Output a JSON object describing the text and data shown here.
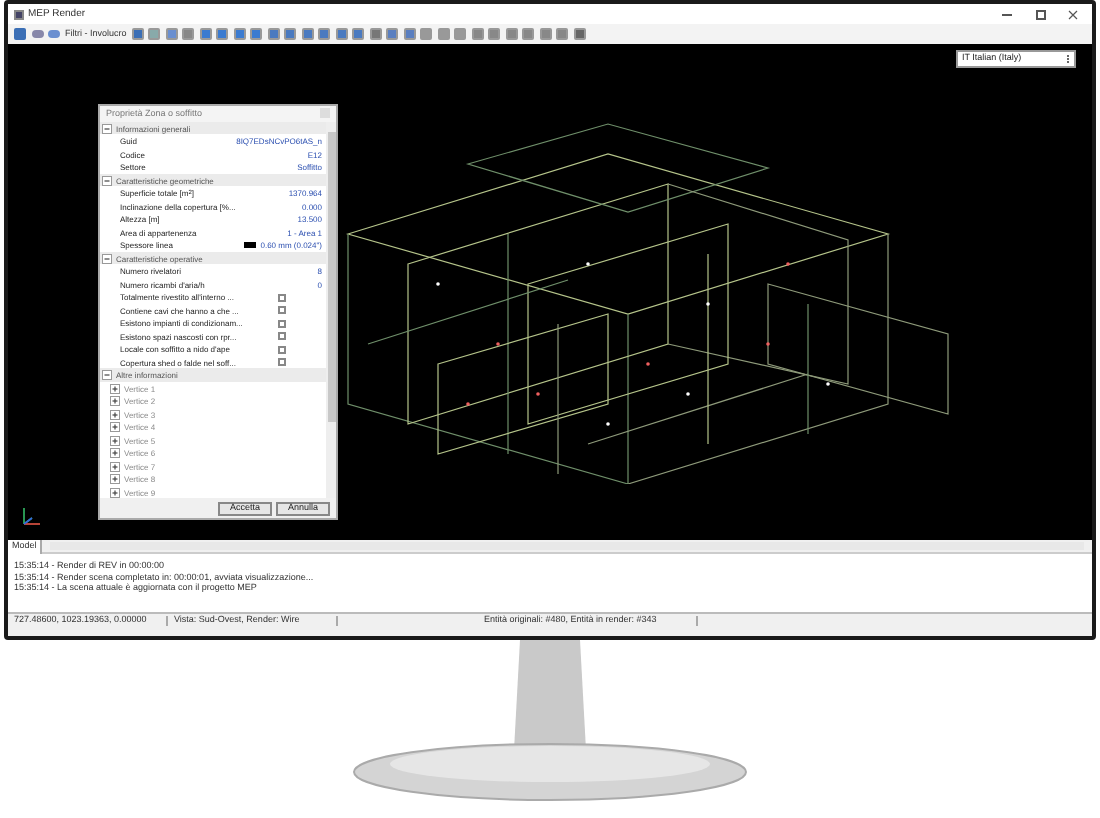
{
  "window": {
    "title": "MEP Render"
  },
  "toolbar": {
    "filter_label": "Filtri - Involucro"
  },
  "language_select": {
    "value": "IT Italian (Italy)"
  },
  "properties_panel": {
    "title": "Proprietà Zona o soffitto",
    "sections": [
      {
        "title": "Informazioni generali",
        "expanded": true,
        "rows": [
          {
            "kind": "text",
            "label": "Guid",
            "value": "8IQ7EDsNCvPO6tAS_n"
          },
          {
            "kind": "text",
            "label": "Codice",
            "value": "E12"
          },
          {
            "kind": "text",
            "label": "Settore",
            "value": "Soffitto"
          }
        ]
      },
      {
        "title": "Caratteristiche geometriche",
        "expanded": true,
        "rows": [
          {
            "kind": "text",
            "label": "Superficie totale [m$^{2}$]",
            "value": "1370.964"
          },
          {
            "kind": "text",
            "label": "Inclinazione della copertura [%...",
            "value": "0.000"
          },
          {
            "kind": "text",
            "label": "Altezza [m]",
            "value": "13.500"
          },
          {
            "kind": "text",
            "label": "Area di appartenenza",
            "value": "1 - Area 1"
          },
          {
            "kind": "line",
            "label": "Spessore linea",
            "value": "0.60 mm (0.024\")"
          }
        ]
      },
      {
        "title": "Caratteristiche operative",
        "expanded": true,
        "rows": [
          {
            "kind": "text",
            "label": "Numero rivelatori",
            "value": "8"
          },
          {
            "kind": "text",
            "label": "Numero ricambi d'aria/h",
            "value": "0"
          },
          {
            "kind": "checkbox",
            "label": "Totalmente rivestito all'interno ...",
            "checked": false
          },
          {
            "kind": "checkbox",
            "label": "Contiene cavi che hanno a che ...",
            "checked": false
          },
          {
            "kind": "checkbox",
            "label": "Esistono impianti di condizionam...",
            "checked": false
          },
          {
            "kind": "checkbox",
            "label": "Esistono spazi nascosti con rpr...",
            "checked": false
          },
          {
            "kind": "checkbox",
            "label": "Locale con soffitto a nido d'ape",
            "checked": false
          },
          {
            "kind": "checkbox",
            "label": "Copertura shed o falde nel soff...",
            "checked": false
          }
        ]
      },
      {
        "title": "Altre informazioni",
        "expanded": true,
        "rows": [
          {
            "kind": "group",
            "label": "Vertice 1",
            "expanded": false
          },
          {
            "kind": "group",
            "label": "Vertice 2",
            "expanded": false
          },
          {
            "kind": "group",
            "label": "Vertice 3",
            "expanded": false
          },
          {
            "kind": "group",
            "label": "Vertice 4",
            "expanded": false
          },
          {
            "kind": "group",
            "label": "Vertice 5",
            "expanded": false
          },
          {
            "kind": "group",
            "label": "Vertice 6",
            "expanded": false
          },
          {
            "kind": "group",
            "label": "Vertice 7",
            "expanded": false
          },
          {
            "kind": "group",
            "label": "Vertice 8",
            "expanded": false
          },
          {
            "kind": "group",
            "label": "Vertice 9",
            "expanded": false
          }
        ]
      }
    ],
    "buttons": [
      "Accetta",
      "Annulla"
    ]
  },
  "tabs": [
    {
      "label": "Model",
      "selected": true
    }
  ],
  "log": [
    "15:35:14 - Render di REV in 00:00:00",
    "15:35:14 - Render scena completato in: 00:00:01, avviata visualizzazione...",
    "15:35:14 - La scena attuale è aggiornata con il progetto MEP"
  ],
  "status_bar": [
    "727.48600, 1023.19363, 0.00000",
    "Vista: Sud-Ovest, Render: Wire",
    "Entità originali: #480, Entità in render: #343"
  ]
}
